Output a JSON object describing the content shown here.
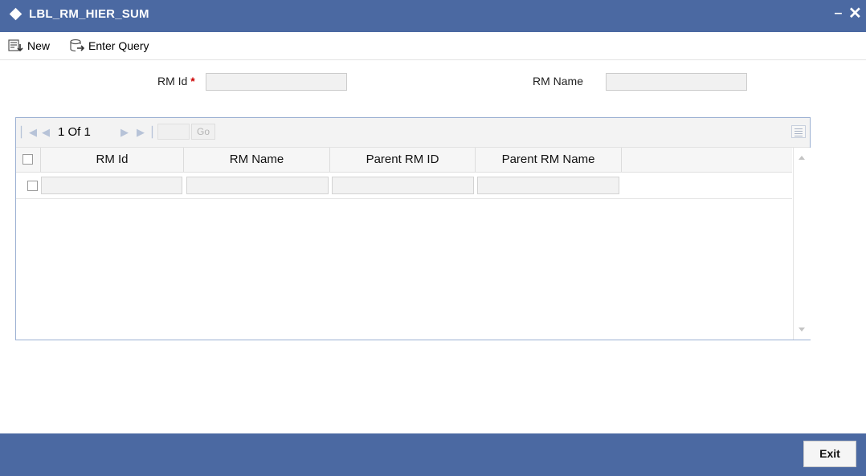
{
  "window": {
    "title": "LBL_RM_HIER_SUM",
    "minimize_glyph": "‒",
    "close_glyph": "✕"
  },
  "toolbar": {
    "new_label": "New",
    "new_icon": "new-record-icon",
    "enter_query_label": "Enter Query",
    "enter_query_icon": "enter-query-icon"
  },
  "form": {
    "rm_id_label": "RM Id",
    "rm_id_required": "*",
    "rm_id_value": "",
    "rm_name_label": "RM Name",
    "rm_name_value": ""
  },
  "pager": {
    "page_text": "1 Of 1",
    "go_label": "Go",
    "page_input": ""
  },
  "table": {
    "columns": [
      "RM Id",
      "RM Name",
      "Parent RM ID",
      "Parent RM Name"
    ],
    "rows": [
      {
        "rm_id": "",
        "rm_name": "",
        "parent_rm_id": "",
        "parent_rm_name": ""
      }
    ]
  },
  "footer": {
    "exit_label": "Exit"
  },
  "colors": {
    "accent": "#4b69a2",
    "required": "#cc0000"
  }
}
